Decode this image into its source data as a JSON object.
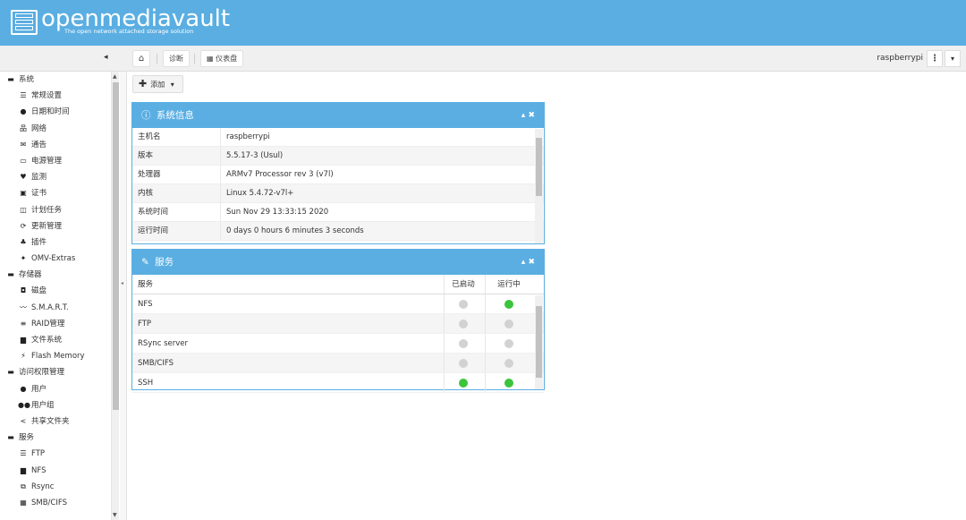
{
  "app": {
    "logo_text": "openmediavault",
    "logo_subtitle": "The open network attached storage solution",
    "user": "raspberrypi"
  },
  "toolbar": {
    "collapse_label": "◂",
    "home_icon": "home-icon",
    "crumb_diagnostics": "诊断",
    "crumb_dashboard": "仪表盘",
    "kebab_label": "⋮",
    "caret_label": "▾"
  },
  "sidebar": {
    "items": [
      {
        "label": "系统",
        "icon": "▬",
        "type": "group"
      },
      {
        "label": "常规设置",
        "icon": "☰",
        "type": "child"
      },
      {
        "label": "日期和时间",
        "icon": "●",
        "type": "child"
      },
      {
        "label": "网络",
        "icon": "品",
        "type": "child"
      },
      {
        "label": "通告",
        "icon": "✉",
        "type": "child"
      },
      {
        "label": "电源管理",
        "icon": "▭",
        "type": "child"
      },
      {
        "label": "监测",
        "icon": "♥",
        "type": "child"
      },
      {
        "label": "证书",
        "icon": "▣",
        "type": "child"
      },
      {
        "label": "计划任务",
        "icon": "◫",
        "type": "child"
      },
      {
        "label": "更新管理",
        "icon": "⟳",
        "type": "child"
      },
      {
        "label": "插件",
        "icon": "♣",
        "type": "child"
      },
      {
        "label": "OMV-Extras",
        "icon": "✦",
        "type": "child"
      },
      {
        "label": "存储器",
        "icon": "▬",
        "type": "group"
      },
      {
        "label": "磁盘",
        "icon": "◘",
        "type": "child"
      },
      {
        "label": "S.M.A.R.T.",
        "icon": "〰",
        "type": "child"
      },
      {
        "label": "RAID管理",
        "icon": "≡",
        "type": "child"
      },
      {
        "label": "文件系统",
        "icon": "▆",
        "type": "child"
      },
      {
        "label": "Flash Memory",
        "icon": "⚡",
        "type": "child"
      },
      {
        "label": "访问权限管理",
        "icon": "▬",
        "type": "group"
      },
      {
        "label": "用户",
        "icon": "●",
        "type": "child"
      },
      {
        "label": "用户组",
        "icon": "●●",
        "type": "child"
      },
      {
        "label": "共享文件夹",
        "icon": "<",
        "type": "child"
      },
      {
        "label": "服务",
        "icon": "▬",
        "type": "group"
      },
      {
        "label": "FTP",
        "icon": "☰",
        "type": "child"
      },
      {
        "label": "NFS",
        "icon": "▆",
        "type": "child"
      },
      {
        "label": "Rsync",
        "icon": "⧉",
        "type": "child"
      },
      {
        "label": "SMB/CIFS",
        "icon": "▦",
        "type": "child"
      }
    ]
  },
  "add_button": {
    "label": "添加",
    "icon": "✚",
    "caret": "▾"
  },
  "sysinfo": {
    "title": "系统信息",
    "title_icon": "ⓘ",
    "controls": "▴ ✖",
    "rows": [
      {
        "key": "主机名",
        "value": "raspberrypi"
      },
      {
        "key": "版本",
        "value": "5.5.17-3 (Usul)"
      },
      {
        "key": "处理器",
        "value": "ARMv7 Processor rev 3 (v7l)"
      },
      {
        "key": "内核",
        "value": "Linux 5.4.72-v7l+"
      },
      {
        "key": "系统时间",
        "value": "Sun Nov 29 13:33:15 2020"
      },
      {
        "key": "运行时间",
        "value": "0 days 0 hours 6 minutes 3 seconds"
      }
    ]
  },
  "services": {
    "title": "服务",
    "title_icon": "🔧",
    "controls": "▴ ✖",
    "col_service": "服务",
    "col_enabled": "已启动",
    "col_running": "运行中",
    "rows": [
      {
        "name": "NFS",
        "enabled": false,
        "running": true
      },
      {
        "name": "FTP",
        "enabled": false,
        "running": false
      },
      {
        "name": "RSync server",
        "enabled": false,
        "running": false
      },
      {
        "name": "SMB/CIFS",
        "enabled": false,
        "running": false
      },
      {
        "name": "SSH",
        "enabled": true,
        "running": true
      }
    ],
    "colors": {
      "on": "#3cc43c",
      "off": "#d2d2d2"
    }
  }
}
